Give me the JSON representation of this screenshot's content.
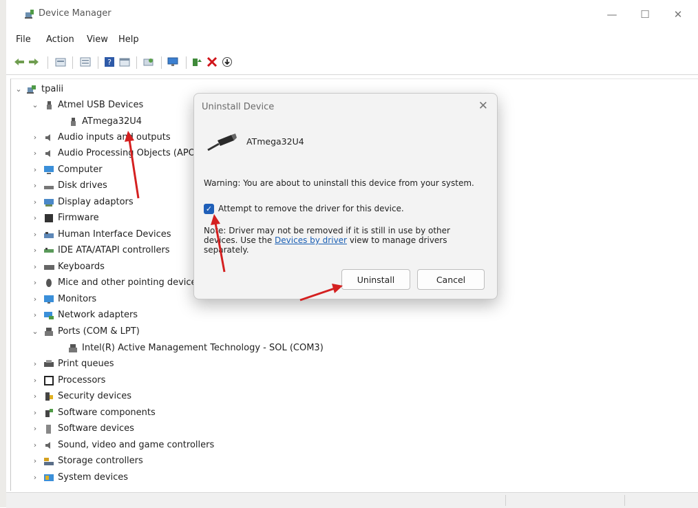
{
  "window": {
    "title": "Device Manager",
    "controls": {
      "minimize": "—",
      "maximize": "☐",
      "close": "✕"
    }
  },
  "menu": [
    "File",
    "Action",
    "View",
    "Help"
  ],
  "toolbar_icons": [
    "back-icon",
    "forward-icon",
    "properties-icon",
    "list-icon",
    "help-icon",
    "view-icon",
    "scan-icon",
    "monitor-icon",
    "update-driver-icon",
    "uninstall-icon",
    "download-icon"
  ],
  "tree": {
    "root": "tpalii",
    "items": [
      {
        "label": "Atmel USB Devices",
        "expanded": true,
        "icon": "usb-icon",
        "children": [
          {
            "label": "ATmega32U4",
            "icon": "usb-icon"
          }
        ]
      },
      {
        "label": "Audio inputs and outputs",
        "icon": "speaker-icon"
      },
      {
        "label": "Audio Processing Objects (APOs)",
        "icon": "speaker-icon"
      },
      {
        "label": "Computer",
        "icon": "computer-icon"
      },
      {
        "label": "Disk drives",
        "icon": "disk-icon"
      },
      {
        "label": "Display adaptors",
        "icon": "display-icon"
      },
      {
        "label": "Firmware",
        "icon": "chip-icon"
      },
      {
        "label": "Human Interface Devices",
        "icon": "hid-icon"
      },
      {
        "label": "IDE ATA/ATAPI controllers",
        "icon": "ide-icon"
      },
      {
        "label": "Keyboards",
        "icon": "keyboard-icon"
      },
      {
        "label": "Mice and other pointing devices",
        "icon": "mouse-icon"
      },
      {
        "label": "Monitors",
        "icon": "monitor-icon"
      },
      {
        "label": "Network adapters",
        "icon": "network-icon"
      },
      {
        "label": "Ports (COM & LPT)",
        "expanded": true,
        "icon": "port-icon",
        "children": [
          {
            "label": "Intel(R) Active Management Technology - SOL (COM3)",
            "icon": "port-icon"
          }
        ]
      },
      {
        "label": "Print queues",
        "icon": "printer-icon"
      },
      {
        "label": "Processors",
        "icon": "processor-icon"
      },
      {
        "label": "Security devices",
        "icon": "security-icon"
      },
      {
        "label": "Software components",
        "icon": "component-icon"
      },
      {
        "label": "Software devices",
        "icon": "software-icon"
      },
      {
        "label": "Sound, video and game controllers",
        "icon": "speaker-icon"
      },
      {
        "label": "Storage controllers",
        "icon": "storage-icon"
      },
      {
        "label": "System devices",
        "icon": "system-icon"
      }
    ]
  },
  "dialog": {
    "title": "Uninstall Device",
    "device_name": "ATmega32U4",
    "warning": "Warning: You are about to uninstall this device from your system.",
    "checkbox_label": "Attempt to remove the driver for this device.",
    "checkbox_checked": true,
    "note_part1": "Note: Driver may not be removed if it is still in use by other devices. Use the ",
    "note_link": "Devices by driver",
    "note_part2": " view to manage drivers separately.",
    "uninstall_label": "Uninstall",
    "cancel_label": "Cancel"
  },
  "colors": {
    "annotation_arrow": "#d42020",
    "checkbox_accent": "#1f5fb8",
    "link": "#1a5fb4"
  }
}
